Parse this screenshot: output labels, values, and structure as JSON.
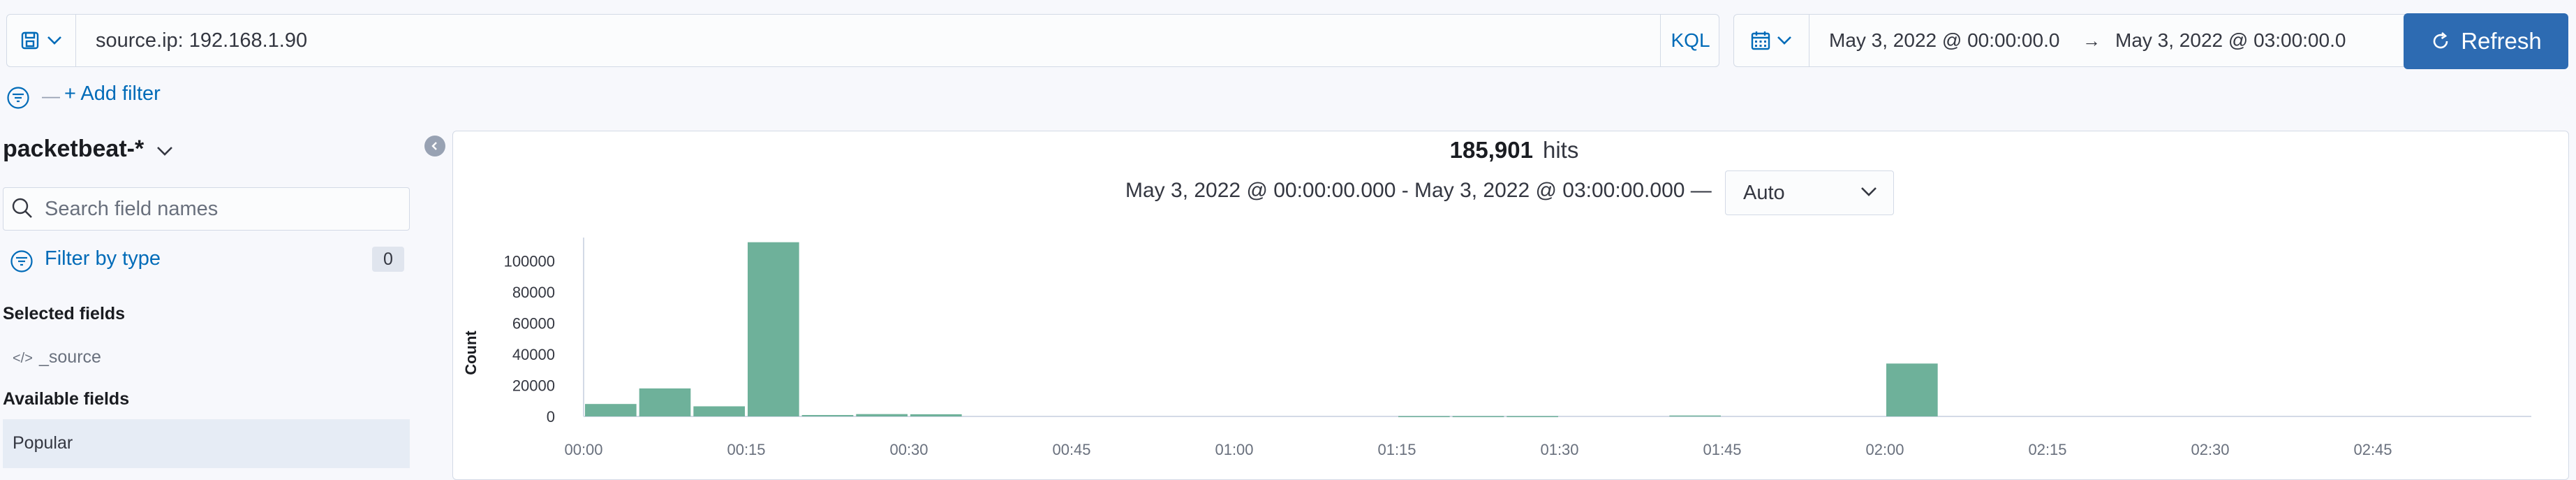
{
  "query_bar": {
    "query": "source.ip: 192.168.1.90",
    "language": "KQL"
  },
  "date_picker": {
    "start": "May 3, 2022 @ 00:00:00.0",
    "arrow": "→",
    "end": "May 3, 2022 @ 03:00:00.0"
  },
  "refresh": {
    "label": "Refresh"
  },
  "filters": {
    "separator": "—",
    "add_label": "+ Add filter"
  },
  "sidebar": {
    "index_pattern": "packetbeat-*",
    "search_placeholder": "Search field names",
    "filter_by_type": "Filter by type",
    "filter_count": "0",
    "selected_fields_title": "Selected fields",
    "selected_fields": [
      "_source"
    ],
    "available_fields_title": "Available fields",
    "popular_label": "Popular"
  },
  "results": {
    "hits_count": "185,901",
    "hits_label": "hits",
    "time_range": "May 3, 2022 @ 00:00:00.000 - May 3, 2022 @ 03:00:00.000 —",
    "interval": "Auto"
  },
  "colors": {
    "accent": "#006bb8",
    "button": "#2d6bb2",
    "bar": "#6eb19a",
    "border": "#d3dae6"
  },
  "chart_data": {
    "type": "bar",
    "ylabel": "Count",
    "ylim": [
      0,
      115000
    ],
    "yticks": [
      "0",
      "20000",
      "40000",
      "60000",
      "80000",
      "100000"
    ],
    "ytick_values": [
      0,
      20000,
      40000,
      60000,
      80000,
      100000
    ],
    "xtick_labels": [
      "00:00",
      "00:15",
      "00:30",
      "00:45",
      "01:00",
      "01:15",
      "01:30",
      "01:45",
      "02:00",
      "02:15",
      "02:30",
      "02:45"
    ],
    "bucket_minutes": 5,
    "x_minutes": [
      0,
      5,
      10,
      15,
      20,
      25,
      30,
      35,
      40,
      45,
      50,
      55,
      60,
      65,
      70,
      75,
      80,
      85,
      90,
      95,
      100,
      105,
      110,
      115,
      120,
      125
    ],
    "values": [
      8000,
      18000,
      6500,
      112000,
      900,
      1500,
      1400,
      0,
      0,
      0,
      0,
      0,
      0,
      0,
      0,
      200,
      200,
      200,
      0,
      0,
      600,
      0,
      0,
      0,
      34000,
      0
    ],
    "grid": false,
    "legend": "none"
  }
}
